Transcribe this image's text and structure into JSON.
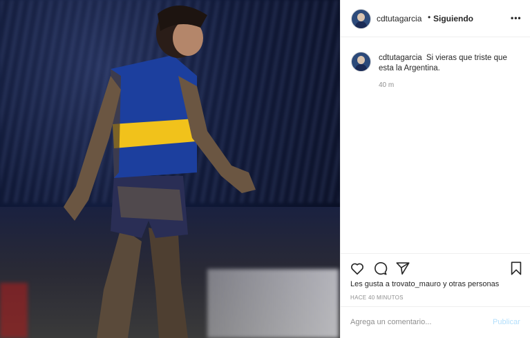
{
  "header": {
    "username": "cdtutagarcia",
    "separator": "•",
    "follow_status": "Siguiendo",
    "more_icon": "more-options-icon"
  },
  "caption": {
    "username": "cdtutagarcia",
    "text": "Si vieras que triste que esta la Argentina.",
    "time": "40 m"
  },
  "actions": {
    "icons": [
      "heart-icon",
      "comment-icon",
      "share-icon",
      "bookmark-icon"
    ],
    "likes_prefix": "Les gusta a",
    "likes_user": "trovato_mauro",
    "likes_suffix": "y otras personas",
    "posted_ago": "HACE 40 MINUTOS"
  },
  "comment_box": {
    "placeholder": "Agrega un comentario...",
    "publish_label": "Publicar"
  },
  "colors": {
    "text": "#262626",
    "muted": "#8e8e8e",
    "publish_disabled": "#b2dffc",
    "jersey_blue": "#1c3f9e",
    "jersey_yellow": "#f1c21b"
  }
}
